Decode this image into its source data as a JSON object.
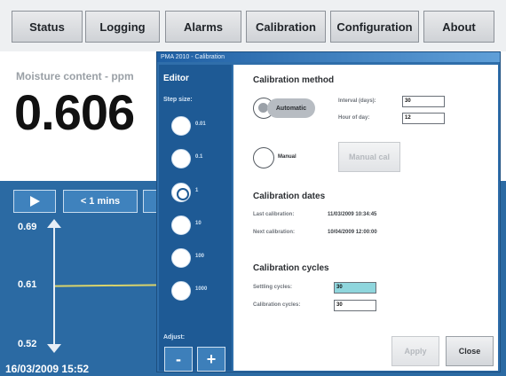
{
  "nav": {
    "tabs": [
      "Status",
      "Logging",
      "Alarms",
      "Calibration",
      "Configuration",
      "About"
    ]
  },
  "main": {
    "moisture_label": "Moisture content - ppm",
    "moisture_value": "0.606",
    "graph": {
      "play_icon": "play-icon",
      "range_label": "< 1 mins",
      "y_max": "0.69",
      "y_mid": "0.61",
      "y_min": "0.52",
      "timestamp": "16/03/2009 15:52",
      "trace_color": "#d9d36b",
      "bg_color": "#2b6aa3"
    }
  },
  "dialog": {
    "title": "PMA 2010 - Calibration",
    "editor": {
      "title": "Editor",
      "step_size_label": "Step size:",
      "steps": [
        "0.01",
        "0.1",
        "1",
        "10",
        "100",
        "1000"
      ],
      "selected_step": "1",
      "adjust_label": "Adjust:",
      "minus": "-",
      "plus": "+"
    },
    "method": {
      "heading": "Calibration method",
      "automatic_label": "Automatic",
      "manual_label": "Manual",
      "manual_button": "Manual cal",
      "interval_label": "Interval (days):",
      "interval_value": "30",
      "hour_label": "Hour of day:",
      "hour_value": "12"
    },
    "dates": {
      "heading": "Calibration dates",
      "last_label": "Last calibration:",
      "last_value": "11/03/2009 10:34:45",
      "next_label": "Next calibration:",
      "next_value": "10/04/2009 12:00:00"
    },
    "cycles": {
      "heading": "Calibration cycles",
      "settling_label": "Settling cycles:",
      "settling_value": "30",
      "calibration_label": "Calibration cycles:",
      "calibration_value": "30"
    },
    "apply_button": "Apply",
    "close_button": "Close"
  }
}
